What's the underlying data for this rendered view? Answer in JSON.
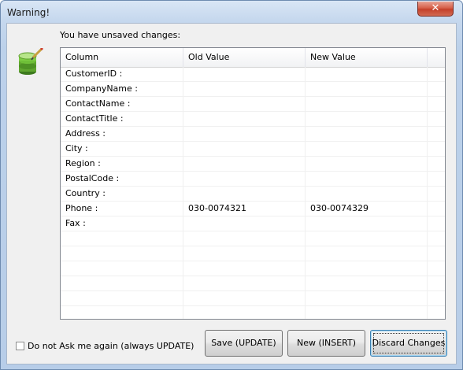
{
  "window": {
    "title": "Warning!",
    "close_glyph": "✕"
  },
  "message": "You have unsaved changes:",
  "grid": {
    "columns": [
      "Column",
      "Old Value",
      "New Value"
    ],
    "rows": [
      {
        "column": "CustomerID :",
        "old": "",
        "new": ""
      },
      {
        "column": "CompanyName :",
        "old": "",
        "new": ""
      },
      {
        "column": "ContactName :",
        "old": "",
        "new": ""
      },
      {
        "column": "ContactTitle :",
        "old": "",
        "new": ""
      },
      {
        "column": "Address :",
        "old": "",
        "new": ""
      },
      {
        "column": "City :",
        "old": "",
        "new": ""
      },
      {
        "column": "Region :",
        "old": "",
        "new": ""
      },
      {
        "column": "PostalCode :",
        "old": "",
        "new": ""
      },
      {
        "column": "Country :",
        "old": "",
        "new": ""
      },
      {
        "column": "Phone :",
        "old": "030-0074321",
        "new": "030-0074329"
      },
      {
        "column": "Fax :",
        "old": "",
        "new": ""
      },
      {
        "column": "",
        "old": "",
        "new": ""
      },
      {
        "column": "",
        "old": "",
        "new": ""
      },
      {
        "column": "",
        "old": "",
        "new": ""
      },
      {
        "column": "",
        "old": "",
        "new": ""
      },
      {
        "column": "",
        "old": "",
        "new": ""
      },
      {
        "column": "",
        "old": "",
        "new": ""
      },
      {
        "column": "",
        "old": "",
        "new": ""
      }
    ]
  },
  "checkbox": {
    "label": "Do not Ask me again (always UPDATE)",
    "checked": false
  },
  "buttons": {
    "save": "Save (UPDATE)",
    "new": "New (INSERT)",
    "discard": "Discard Changes"
  },
  "icons": {
    "database": "database-edit-icon"
  }
}
